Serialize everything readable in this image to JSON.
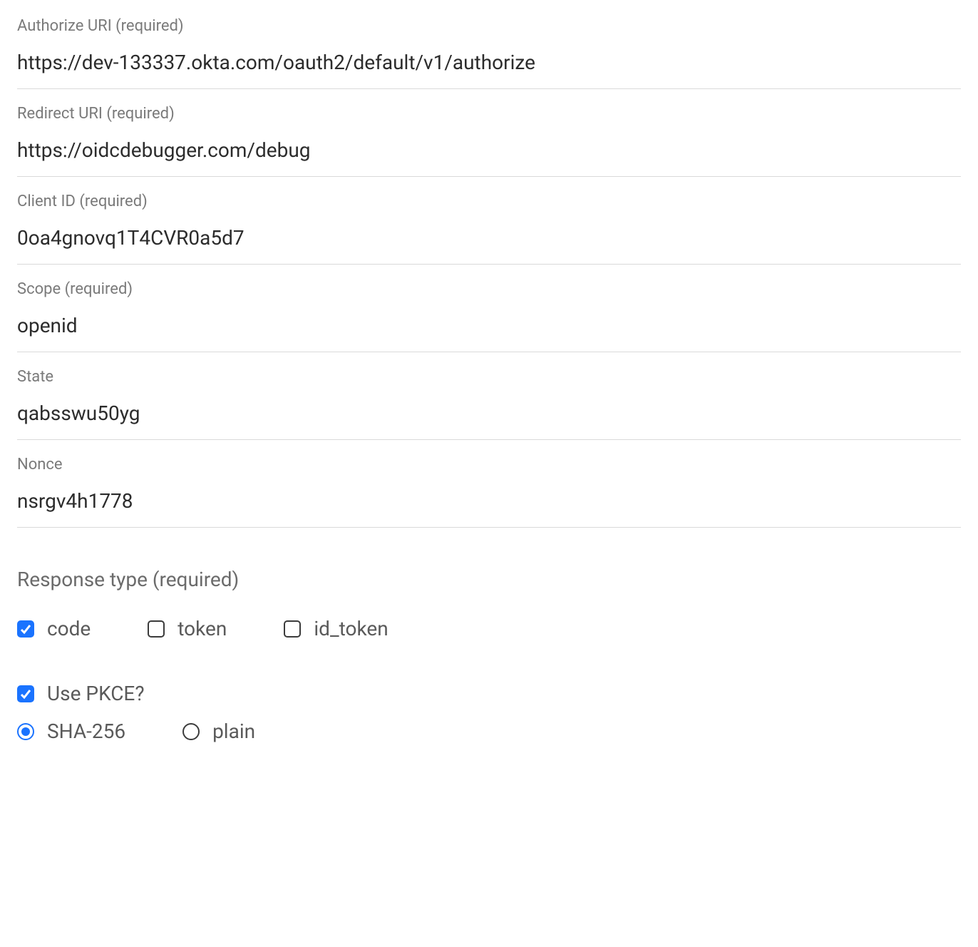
{
  "fields": {
    "authorize_uri": {
      "label": "Authorize URI (required)",
      "value": "https://dev-133337.okta.com/oauth2/default/v1/authorize"
    },
    "redirect_uri": {
      "label": "Redirect URI (required)",
      "value": "https://oidcdebugger.com/debug"
    },
    "client_id": {
      "label": "Client ID (required)",
      "value": "0oa4gnovq1T4CVR0a5d7"
    },
    "scope": {
      "label": "Scope (required)",
      "value": "openid"
    },
    "state": {
      "label": "State",
      "value": "qabsswu50yg"
    },
    "nonce": {
      "label": "Nonce",
      "value": "nsrgv4h1778"
    }
  },
  "response_type": {
    "heading": "Response type (required)",
    "options": {
      "code": {
        "label": "code",
        "checked": true
      },
      "token": {
        "label": "token",
        "checked": false
      },
      "id_token": {
        "label": "id_token",
        "checked": false
      }
    }
  },
  "pkce": {
    "use_label": "Use PKCE?",
    "use_checked": true,
    "methods": {
      "sha256": {
        "label": "SHA-256",
        "selected": true
      },
      "plain": {
        "label": "plain",
        "selected": false
      }
    }
  }
}
